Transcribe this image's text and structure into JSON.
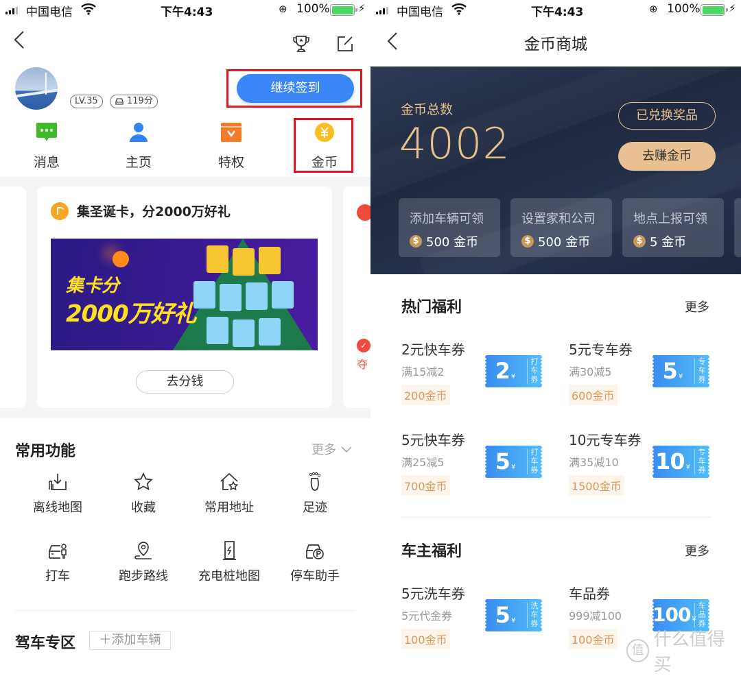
{
  "status_bar": {
    "carrier": "中国电信",
    "time": "下午4:43",
    "battery": "100%"
  },
  "left": {
    "user": {
      "level": "LV.35",
      "drive_score": "119分"
    },
    "sign_in_button": "继续签到",
    "quick_nav": [
      {
        "label": "消息",
        "icon": "message-icon"
      },
      {
        "label": "主页",
        "icon": "user-icon"
      },
      {
        "label": "特权",
        "icon": "privilege-icon"
      },
      {
        "label": "金币",
        "icon": "coin-icon"
      }
    ],
    "promo_card": {
      "title": "集圣诞卡，分2000万好礼",
      "banner_line1": "集卡分",
      "banner_line2": "2000万好礼",
      "button": "去分钱"
    },
    "right_card_partial_text": "夺",
    "common_functions": {
      "title": "常用功能",
      "more": "更多",
      "items": [
        {
          "label": "离线地图",
          "icon": "offline-map-icon"
        },
        {
          "label": "收藏",
          "icon": "star-icon"
        },
        {
          "label": "常用地址",
          "icon": "home-star-icon"
        },
        {
          "label": "足迹",
          "icon": "footprint-icon"
        },
        {
          "label": "打车",
          "icon": "taxi-icon"
        },
        {
          "label": "跑步路线",
          "icon": "running-route-icon"
        },
        {
          "label": "充电桩地图",
          "icon": "charging-station-icon"
        },
        {
          "label": "停车助手",
          "icon": "parking-icon"
        }
      ]
    },
    "driving_zone": {
      "title": "驾车专区",
      "add_vehicle": "＋添加车辆"
    }
  },
  "right": {
    "nav_title": "金币商城",
    "coins": {
      "label": "金币总数",
      "total": "4002",
      "redeemed_button": "已兑换奖品",
      "earn_button": "去赚金币"
    },
    "tasks": [
      {
        "title": "添加车辆可领",
        "reward": "500 金币"
      },
      {
        "title": "设置家和公司",
        "reward": "500 金币"
      },
      {
        "title": "地点上报可领",
        "reward": "5 金币"
      }
    ],
    "hot_benefits": {
      "title": "热门福利",
      "more": "更多",
      "items": [
        {
          "name": "2元快车券",
          "desc": "满15减2",
          "price": "200金币",
          "amount": "2",
          "kind": "打车券"
        },
        {
          "name": "5元专车券",
          "desc": "满30减5",
          "price": "600金币",
          "amount": "5",
          "kind": "专车券"
        },
        {
          "name": "5元快车券",
          "desc": "满25减5",
          "price": "700金币",
          "amount": "5",
          "kind": "打车券"
        },
        {
          "name": "10元专车券",
          "desc": "满35减10",
          "price": "1500金币",
          "amount": "10",
          "kind": "专车券"
        }
      ]
    },
    "owner_benefits": {
      "title": "车主福利",
      "more": "更多",
      "items": [
        {
          "name": "5元洗车券",
          "desc": "5元代金券",
          "price": "100金币",
          "amount": "5",
          "kind": "洗车券"
        },
        {
          "name": "车品券",
          "desc": "999减100",
          "price": "100金币",
          "amount": "100",
          "kind": "车品券"
        }
      ]
    },
    "currency_symbol": "¥"
  },
  "watermark": {
    "icon_text": "值",
    "text": "什么值得买"
  },
  "colors": {
    "primary_blue": "#3b86f6",
    "highlight_red": "#e0141e",
    "gold": "#e8c28e",
    "hero_navy": "#1f2940",
    "price_orange": "#d89a5a"
  }
}
